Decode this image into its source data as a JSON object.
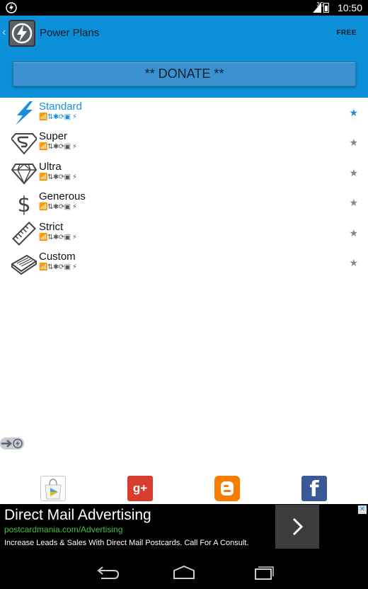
{
  "status_bar": {
    "time": "10:50",
    "network": "3G",
    "icons": [
      "app-icon",
      "signal-icon",
      "battery-icon"
    ]
  },
  "action_bar": {
    "title": "Power Plans",
    "badge": "FREE",
    "donate_label": "** DONATE **",
    "accent_color": "#0a8fd8"
  },
  "plans": [
    {
      "name": "Standard",
      "icon": "lightning-icon",
      "status": "📶⇅✱⟳▣ ⚡",
      "active": true,
      "starred": true
    },
    {
      "name": "Super",
      "icon": "superman-icon",
      "status": "📶⇅✱⟳▣ ⚡",
      "active": false,
      "starred": false
    },
    {
      "name": "Ultra",
      "icon": "diamond-icon",
      "status": "📶⇅✱⟳▣ ⚡",
      "active": false,
      "starred": false
    },
    {
      "name": "Generous",
      "icon": "dollar-icon",
      "status": "📶⇅✱⟳▣ ⚡",
      "active": false,
      "starred": false
    },
    {
      "name": "Strict",
      "icon": "ruler-icon",
      "status": "📶⇅✱⟳▣ ⚡",
      "active": false,
      "starred": false
    },
    {
      "name": "Custom",
      "icon": "notepad-icon",
      "status": "📶⇅✱⟳▣ ⚡",
      "active": false,
      "starred": false
    }
  ],
  "share": {
    "items": [
      "google-play-icon",
      "google-plus-icon",
      "blogger-icon",
      "facebook-icon"
    ],
    "gplus_label": "g+",
    "fb_label": "f"
  },
  "ad": {
    "headline": "Direct Mail Advertising",
    "url": "postcardmania.com/Advertising",
    "description": "Increase Leads & Sales With Direct Mail Postcards. Call For A Consult.",
    "close_label": "✕",
    "arrow_label": "›"
  },
  "nav": {
    "items": [
      "back-icon",
      "home-icon",
      "recents-icon"
    ]
  }
}
